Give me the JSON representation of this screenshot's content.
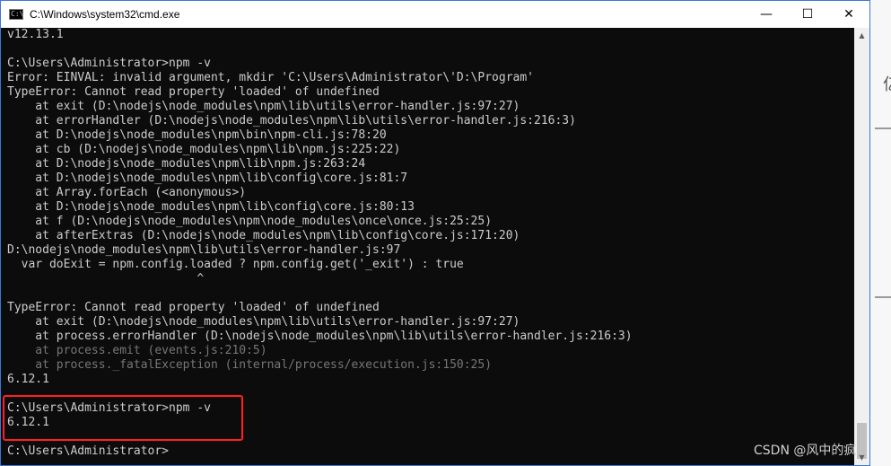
{
  "window": {
    "title": "C:\\Windows\\system32\\cmd.exe",
    "icon": "cmd-icon",
    "minimize_glyph": "—",
    "maximize_glyph": "☐",
    "close_glyph": "✕"
  },
  "console": {
    "lines": [
      {
        "text": "v12.13.1",
        "dim": false
      },
      {
        "text": "",
        "dim": false
      },
      {
        "text": "C:\\Users\\Administrator>npm -v",
        "dim": false
      },
      {
        "text": "Error: EINVAL: invalid argument, mkdir 'C:\\Users\\Administrator\\'D:\\Program'",
        "dim": false
      },
      {
        "text": "TypeError: Cannot read property 'loaded' of undefined",
        "dim": false
      },
      {
        "text": "    at exit (D:\\nodejs\\node_modules\\npm\\lib\\utils\\error-handler.js:97:27)",
        "dim": false
      },
      {
        "text": "    at errorHandler (D:\\nodejs\\node_modules\\npm\\lib\\utils\\error-handler.js:216:3)",
        "dim": false
      },
      {
        "text": "    at D:\\nodejs\\node_modules\\npm\\bin\\npm-cli.js:78:20",
        "dim": false
      },
      {
        "text": "    at cb (D:\\nodejs\\node_modules\\npm\\lib\\npm.js:225:22)",
        "dim": false
      },
      {
        "text": "    at D:\\nodejs\\node_modules\\npm\\lib\\npm.js:263:24",
        "dim": false
      },
      {
        "text": "    at D:\\nodejs\\node_modules\\npm\\lib\\config\\core.js:81:7",
        "dim": false
      },
      {
        "text": "    at Array.forEach (<anonymous>)",
        "dim": false
      },
      {
        "text": "    at D:\\nodejs\\node_modules\\npm\\lib\\config\\core.js:80:13",
        "dim": false
      },
      {
        "text": "    at f (D:\\nodejs\\node_modules\\npm\\node_modules\\once\\once.js:25:25)",
        "dim": false
      },
      {
        "text": "    at afterExtras (D:\\nodejs\\node_modules\\npm\\lib\\config\\core.js:171:20)",
        "dim": false
      },
      {
        "text": "D:\\nodejs\\node_modules\\npm\\lib\\utils\\error-handler.js:97",
        "dim": false
      },
      {
        "text": "  var doExit = npm.config.loaded ? npm.config.get('_exit') : true",
        "dim": false
      },
      {
        "text": "                           ^",
        "dim": false
      },
      {
        "text": "",
        "dim": false
      },
      {
        "text": "TypeError: Cannot read property 'loaded' of undefined",
        "dim": false
      },
      {
        "text": "    at exit (D:\\nodejs\\node_modules\\npm\\lib\\utils\\error-handler.js:97:27)",
        "dim": false
      },
      {
        "text": "    at process.errorHandler (D:\\nodejs\\node_modules\\npm\\lib\\utils\\error-handler.js:216:3)",
        "dim": false
      },
      {
        "text": "    at process.emit (events.js:210:5)",
        "dim": true
      },
      {
        "text": "    at process._fatalException (internal/process/execution.js:150:25)",
        "dim": true
      },
      {
        "text": "6.12.1",
        "dim": false
      },
      {
        "text": "",
        "dim": false
      },
      {
        "text": "C:\\Users\\Administrator>npm -v",
        "dim": false
      },
      {
        "text": "6.12.1",
        "dim": false
      },
      {
        "text": "",
        "dim": false
      },
      {
        "text": "C:\\Users\\Administrator>",
        "dim": false
      }
    ]
  },
  "watermark": "CSDN @风中的疯",
  "colors": {
    "console_bg": "#0c0c0c",
    "console_fg": "#cccccc",
    "highlight": "#ff2020",
    "window_border": "#3a78d1"
  }
}
